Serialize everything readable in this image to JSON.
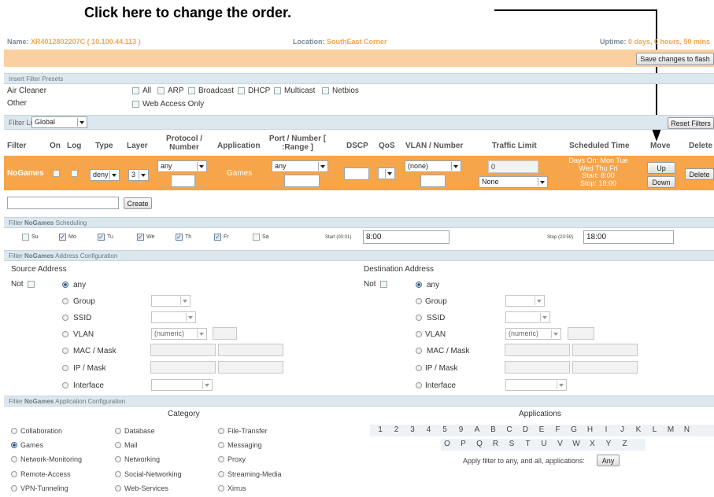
{
  "annotation": "Click here to change the order.",
  "header": {
    "name_label": "Name:",
    "name_value": "XR4012802207C   ( 10.100.44.113 )",
    "location_label": "Location:",
    "location_value": "SouthEast Corner",
    "uptime_label": "Uptime:",
    "uptime_value": "0 days, 0 hours, 50 mins",
    "save_button": "Save changes to flash"
  },
  "presets": {
    "bar": "Insert Filter Presets",
    "air_cleaner": "Air Cleaner",
    "other": "Other",
    "items": [
      "All",
      "ARP",
      "Broadcast",
      "DHCP",
      "Multicast",
      "Netbios"
    ],
    "web_access": "Web Access Only"
  },
  "filter_list": {
    "label": "Filter List",
    "value": "Global",
    "reset": "Reset Filters"
  },
  "columns": {
    "filter": "Filter",
    "on": "On",
    "log": "Log",
    "type": "Type",
    "layer": "Layer",
    "protocol": "Protocol / Number",
    "application": "Application",
    "port": "Port / Number [ :Range ]",
    "dscp": "DSCP",
    "qos": "QoS",
    "vlan": "VLAN / Number",
    "traffic": "Traffic Limit",
    "scheduled": "Scheduled Time",
    "move": "Move",
    "delete": "Delete"
  },
  "row": {
    "name": "NoGames",
    "type": "deny",
    "layer": "3",
    "protocol": "any",
    "application": "Games",
    "port": "any",
    "vlan": "(none)",
    "traffic_value": "0",
    "traffic_unit": "None",
    "schedule": [
      "Days On: Mon Tue",
      "Wed Thu Fri",
      "Start: 8:00",
      "Stop: 18:00"
    ],
    "up": "Up",
    "down": "Down",
    "delete": "Delete"
  },
  "create": "Create",
  "scheduling": {
    "bar_prefix": "Filter",
    "bar_name": "NoGames",
    "bar_suffix": "Scheduling",
    "days": [
      "Su",
      "Mo",
      "Tu",
      "We",
      "Th",
      "Fr",
      "Sa"
    ],
    "start_label": "Start (00:01)",
    "start_value": "8:00",
    "stop_label": "Stop (23:59)",
    "stop_value": "18:00"
  },
  "address": {
    "bar_prefix": "Filter",
    "bar_name": "NoGames",
    "bar_suffix": "Address Configuration",
    "source": "Source Address",
    "destination": "Destination Address",
    "not": "Not",
    "any": "any",
    "group": "Group",
    "ssid": "SSID",
    "vlan": "VLAN",
    "vlan_select": "(numeric)",
    "mac": "MAC / Mask",
    "ip": "IP / Mask",
    "interface": "Interface"
  },
  "application_cfg": {
    "bar_prefix": "Filter",
    "bar_name": "NoGames",
    "bar_suffix": "Application Configuration",
    "category": "Category",
    "applications": "Applications",
    "categories": [
      "Collaboration",
      "Database",
      "File-Transfer",
      "Games",
      "Mail",
      "Messaging",
      "Network-Monitoring",
      "Networking",
      "Proxy",
      "Remote-Access",
      "Social-Networking",
      "Streaming-Media",
      "VPN-Tunneling",
      "Web-Services",
      "Xirrus"
    ],
    "selected_category": "Games",
    "row1": [
      "1",
      "2",
      "3",
      "4",
      "5",
      "9",
      "A",
      "B",
      "C",
      "D",
      "E",
      "F",
      "G",
      "H",
      "I",
      "J",
      "K",
      "L",
      "M",
      "N"
    ],
    "row2": [
      "O",
      "P",
      "Q",
      "R",
      "S",
      "T",
      "U",
      "V",
      "W",
      "X",
      "Y",
      "Z"
    ],
    "apply_text": "Apply filter to any, and all, applications:",
    "any_button": "Any"
  },
  "colors": {
    "orange": "#f7a54a",
    "header_text": "#f7a54a",
    "bar_bg": "#dde7ee"
  }
}
